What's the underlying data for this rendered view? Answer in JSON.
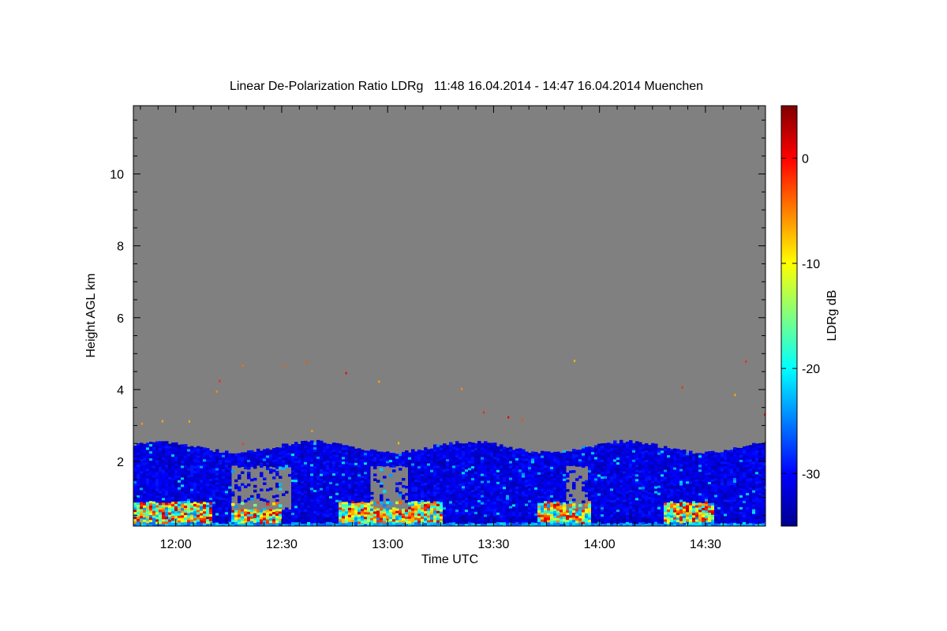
{
  "chart_data": {
    "type": "heatmap",
    "title": "Linear De-Polarization Ratio LDRg   11:48 16.04.2014 - 14:47 16.04.2014 Muenchen",
    "xlabel": "Time UTC",
    "ylabel": "Height AGL km",
    "colorbar_label": "LDRg dB",
    "x_range": [
      "11:48",
      "14:47"
    ],
    "x_ticks": [
      "12:00",
      "12:30",
      "13:00",
      "13:30",
      "14:00",
      "14:30"
    ],
    "ylim": [
      0.2,
      11.9
    ],
    "y_ticks": [
      2,
      4,
      6,
      8,
      10
    ],
    "colorbar_range": [
      -35,
      5
    ],
    "colorbar_ticks": [
      0,
      -10,
      -20,
      -30
    ],
    "colormap": "jet",
    "colors": {
      "no_signal": "#808080",
      "low": "#00008f",
      "high": "#800000"
    },
    "features": {
      "boundary_layer_top_km": 2.4,
      "depolarizing_layer_top_km": 0.9
    }
  }
}
